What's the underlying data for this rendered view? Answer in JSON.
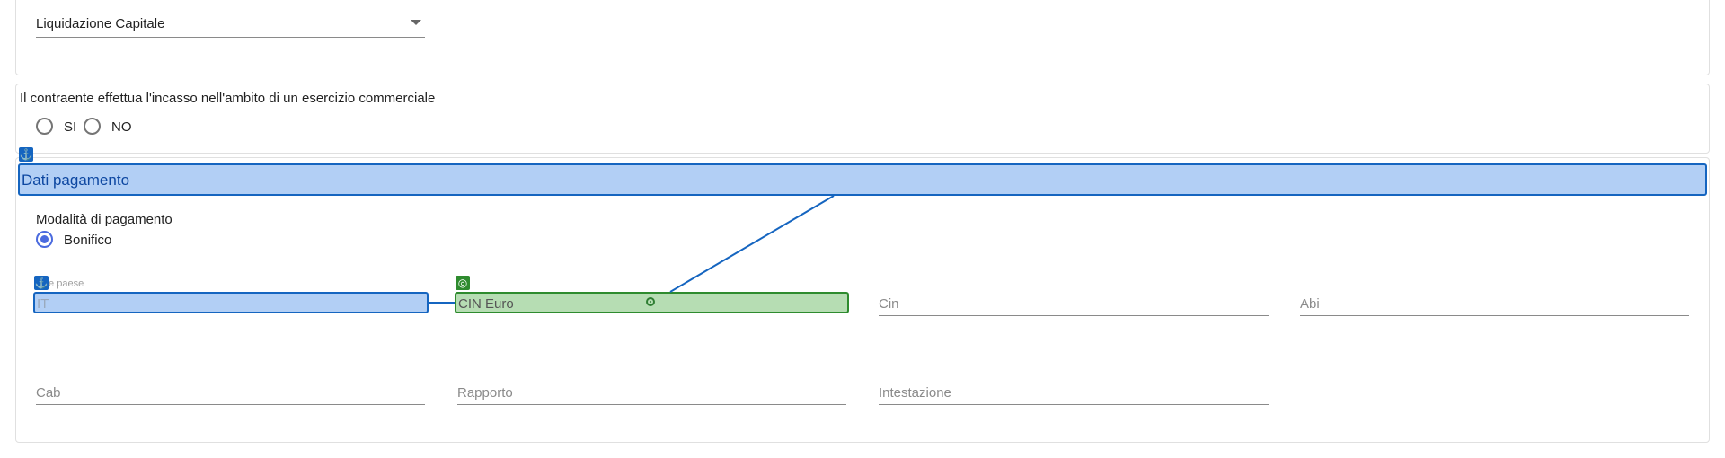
{
  "payment_type": {
    "selected": "Liquidazione Capitale"
  },
  "commercial": {
    "question": "Il contraente effettua l'incasso nell'ambito di un esercizio commerciale",
    "options": [
      "SI",
      "NO"
    ]
  },
  "payment_section": {
    "title": "Dati pagamento",
    "mode_label": "Modalità di pagamento",
    "mode_option": "Bonifico",
    "fields": {
      "codice_paese_label": "dice paese",
      "codice_paese_value": "IT",
      "cin_euro": "CIN Euro",
      "cin": "Cin",
      "abi": "Abi",
      "cab": "Cab",
      "rapporto": "Rapporto",
      "intestazione": "Intestazione"
    }
  },
  "annotations": {
    "anchor_glyph": "⚓",
    "target_glyph": "◎",
    "colors": {
      "anchor": "#1565c0",
      "anchor_fill": "#b2cff5",
      "target": "#2e8b2e",
      "target_fill": "#b6ddb3",
      "radio_selected": "#4b6bdf"
    }
  }
}
